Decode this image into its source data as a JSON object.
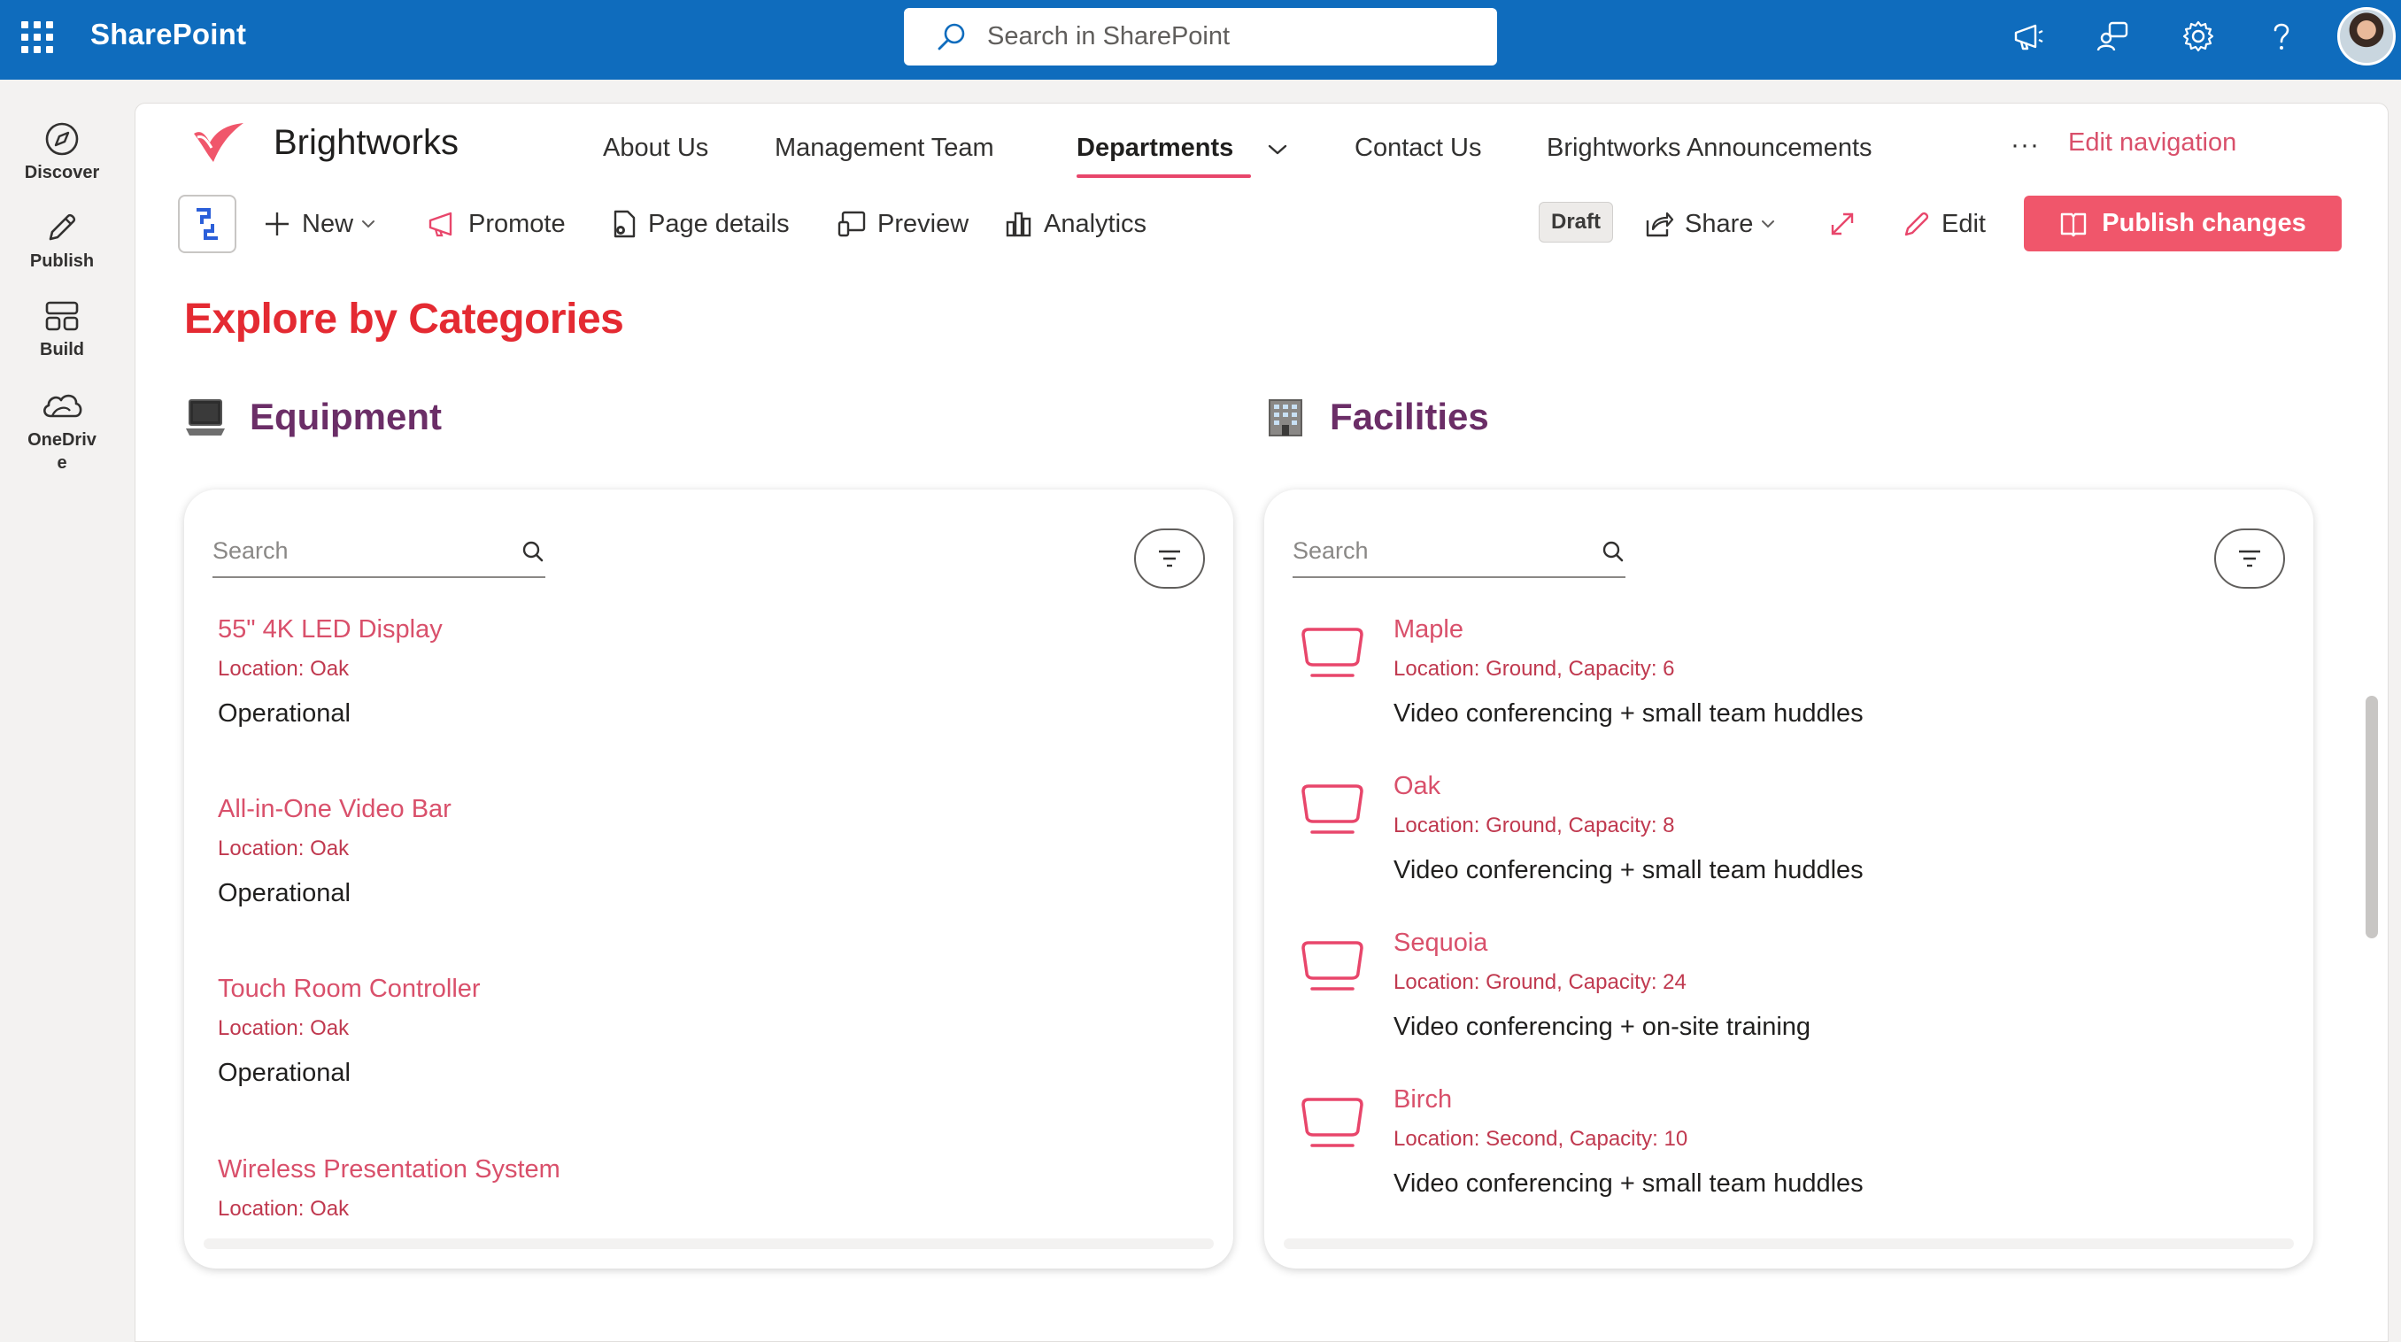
{
  "suite": {
    "app_name": "SharePoint",
    "search_placeholder": "Search in SharePoint"
  },
  "rail": [
    {
      "label": "Discover",
      "icon": "compass-icon"
    },
    {
      "label": "Publish",
      "icon": "pen-icon"
    },
    {
      "label": "Build",
      "icon": "layout-icon"
    },
    {
      "label": "OneDriv\ne",
      "icon": "cloud-icon"
    }
  ],
  "site": {
    "title": "Brightworks",
    "nav": [
      "About Us",
      "Management Team",
      "Departments",
      "Contact Us",
      "Brightworks Announcements"
    ],
    "edit_navigation": "Edit navigation",
    "more": "···"
  },
  "commands": {
    "new": "New",
    "promote": "Promote",
    "page_details": "Page details",
    "preview": "Preview",
    "analytics": "Analytics",
    "draft": "Draft",
    "share": "Share",
    "edit": "Edit",
    "publish": "Publish changes"
  },
  "page": {
    "heading": "Explore by Categories",
    "equipment": {
      "label": "Equipment",
      "search_placeholder": "Search",
      "items": [
        {
          "title": "55\" 4K LED Display",
          "location": "Location: Oak",
          "status": "Operational"
        },
        {
          "title": "All-in-One Video Bar",
          "location": "Location: Oak",
          "status": "Operational"
        },
        {
          "title": "Touch Room Controller",
          "location": "Location: Oak",
          "status": "Operational"
        },
        {
          "title": "Wireless Presentation System",
          "location": "Location: Oak",
          "status": ""
        }
      ]
    },
    "facilities": {
      "label": "Facilities",
      "search_placeholder": "Search",
      "items": [
        {
          "title": "Maple",
          "location": "Location: Ground, Capacity: 6",
          "desc": "Video conferencing + small team huddles"
        },
        {
          "title": "Oak",
          "location": "Location: Ground, Capacity: 8",
          "desc": "Video conferencing + small team huddles"
        },
        {
          "title": "Sequoia",
          "location": "Location: Ground, Capacity: 24",
          "desc": "Video conferencing + on-site training"
        },
        {
          "title": "Birch",
          "location": "Location: Second, Capacity: 10",
          "desc": "Video conferencing + small team huddles"
        }
      ]
    }
  },
  "colors": {
    "suite_bar": "#0f6cbd",
    "accent": "#f0566b",
    "heading": "#e42a32",
    "category": "#6b2e67",
    "link": "#d9506b"
  }
}
